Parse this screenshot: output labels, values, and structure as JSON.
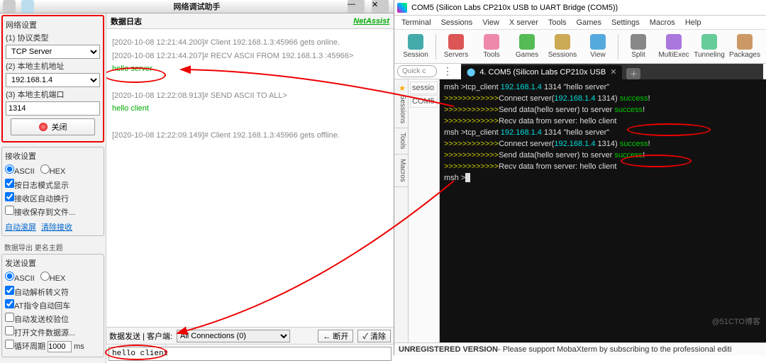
{
  "left": {
    "title": "网络调试助手",
    "net_group": "网络设置",
    "protocol_label": "(1) 协议类型",
    "protocol_value": "TCP Server",
    "host_label": "(2) 本地主机地址",
    "host_value": "192.168.1.4",
    "port_label": "(3) 本地主机端口",
    "port_value": "1314",
    "close_btn": "关闭",
    "recv_group": "接收设置",
    "ascii": "ASCII",
    "hex": "HEX",
    "chk1": "按日志模式显示",
    "chk2": "接收区自动换行",
    "chk3": "接收保存到文件...",
    "lnk1": "自动滚屏",
    "lnk2": "清除接收",
    "export_group": "数据导出  更名主题",
    "send_group": "发送设置",
    "schk1": "自动解析转义符",
    "schk2": "AT指令自动回车",
    "schk3": "自动发送校验位",
    "schk4": "打开文件数据源...",
    "cycle_label": "循环周期",
    "cycle_value": "1000",
    "cycle_unit": "ms",
    "log_header": "数据日志",
    "netassist": "NetAssist",
    "log_lines": [
      {
        "t": "[2020-10-08 12:21:44.200]# Client 192.168.1.3:45966 gets online.",
        "c": ""
      },
      {
        "t": "[2020-10-08 12:21:44.207]# RECV ASCII FROM 192.168.1.3 :45966>",
        "c": ""
      },
      {
        "t": "hello server",
        "c": "green"
      },
      {
        "t": "",
        "c": ""
      },
      {
        "t": "[2020-10-08 12:22:08.913]# SEND ASCII TO ALL>",
        "c": ""
      },
      {
        "t": "hello client",
        "c": "green"
      },
      {
        "t": "",
        "c": ""
      },
      {
        "t": "[2020-10-08 12:22:09.149]# Client 192.168.1.3:45966 gets offline.",
        "c": ""
      }
    ],
    "send_hdr_label": "数据发送 | 客户端:",
    "send_conn": "All Connections (0)",
    "send_disc": "← 断开",
    "send_clear": "✓ 清除",
    "send_value": "hello client"
  },
  "right": {
    "title": "COM5  (Silicon Labs CP210x USB to UART Bridge (COM5))",
    "menus": [
      "Terminal",
      "Sessions",
      "View",
      "X server",
      "Tools",
      "Games",
      "Settings",
      "Macros",
      "Help"
    ],
    "toolbar": [
      {
        "l": "Session",
        "c": "#4aa"
      },
      {
        "l": "Servers",
        "c": "#d55"
      },
      {
        "l": "Tools",
        "c": "#e8a"
      },
      {
        "l": "Games",
        "c": "#5b5"
      },
      {
        "l": "Sessions",
        "c": "#ca5"
      },
      {
        "l": "View",
        "c": "#5ad"
      },
      {
        "l": "Split",
        "c": "#888"
      },
      {
        "l": "MultiExec",
        "c": "#a7d"
      },
      {
        "l": "Tunneling",
        "c": "#6c9"
      },
      {
        "l": "Packages",
        "c": "#c96"
      }
    ],
    "quick": "Quick c",
    "tab_label": "4. COM5  (Silicon Labs CP210x USB",
    "side_tabs": [
      "Sessions",
      "Tools",
      "Macros"
    ],
    "sess_items": [
      "sessio",
      "COM5"
    ],
    "term_lines": [
      [
        {
          "c": "w",
          "t": "msh >tcp_client "
        },
        {
          "c": "c",
          "t": "192.168.1.4"
        },
        {
          "c": "w",
          "t": " 1314 \"hello server\""
        }
      ],
      [
        {
          "c": "y",
          "t": ">>>>>>>>>>>>"
        },
        {
          "c": "w",
          "t": "Connect server("
        },
        {
          "c": "c",
          "t": "192.168.1.4"
        },
        {
          "c": "w",
          "t": " 1314) "
        },
        {
          "c": "g",
          "t": "success"
        },
        {
          "c": "w",
          "t": "!"
        }
      ],
      [
        {
          "c": "y",
          "t": ">>>>>>>>>>>>"
        },
        {
          "c": "w",
          "t": "Send data(hello server) to server "
        },
        {
          "c": "g",
          "t": "success"
        },
        {
          "c": "w",
          "t": "!"
        }
      ],
      [
        {
          "c": "y",
          "t": ">>>>>>>>>>>>"
        },
        {
          "c": "w",
          "t": "Recv data from server: "
        },
        {
          "c": "w",
          "t": "hello client"
        }
      ],
      [
        {
          "c": "w",
          "t": "msh >tcp_client "
        },
        {
          "c": "c",
          "t": "192.168.1.4"
        },
        {
          "c": "w",
          "t": " 1314 "
        },
        {
          "c": "w",
          "t": "\"hello server\""
        }
      ],
      [
        {
          "c": "y",
          "t": ">>>>>>>>>>>>"
        },
        {
          "c": "w",
          "t": "Connect server("
        },
        {
          "c": "c",
          "t": "192.168.1.4"
        },
        {
          "c": "w",
          "t": " 1314) "
        },
        {
          "c": "g",
          "t": "success"
        },
        {
          "c": "w",
          "t": "!"
        }
      ],
      [
        {
          "c": "y",
          "t": ">>>>>>>>>>>>"
        },
        {
          "c": "w",
          "t": "Send data(hello server) to server "
        },
        {
          "c": "g",
          "t": "success"
        },
        {
          "c": "w",
          "t": "!"
        }
      ],
      [
        {
          "c": "y",
          "t": ">>>>>>>>>>>>"
        },
        {
          "c": "w",
          "t": "Recv data from server: "
        },
        {
          "c": "w",
          "t": "hello client"
        }
      ],
      [
        {
          "c": "w",
          "t": "msh >"
        }
      ]
    ],
    "footer_bold": "UNREGISTERED VERSION",
    "footer_rest": " -  Please support MobaXterm by subscribing to the professional editi",
    "watermark": "@51CTO博客"
  }
}
